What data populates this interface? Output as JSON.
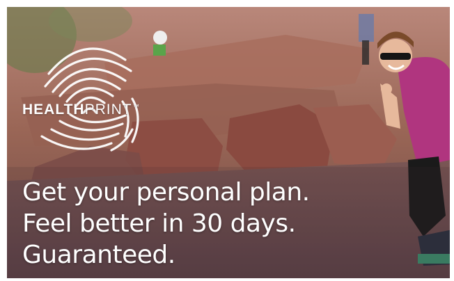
{
  "brand": {
    "name_bold": "HEALTH",
    "name_light": "PRINT",
    "trademark": "™"
  },
  "headline": {
    "line1": "Get your personal plan.",
    "line2": "Feel better in 30 days.",
    "line3": "Guaranteed."
  },
  "colors": {
    "text": "#ffffff",
    "rock": "#8e5648",
    "shirt": "#b0357f",
    "sky_tint": "#c49488"
  },
  "icons": {
    "logo": "fingerprint-icon"
  }
}
